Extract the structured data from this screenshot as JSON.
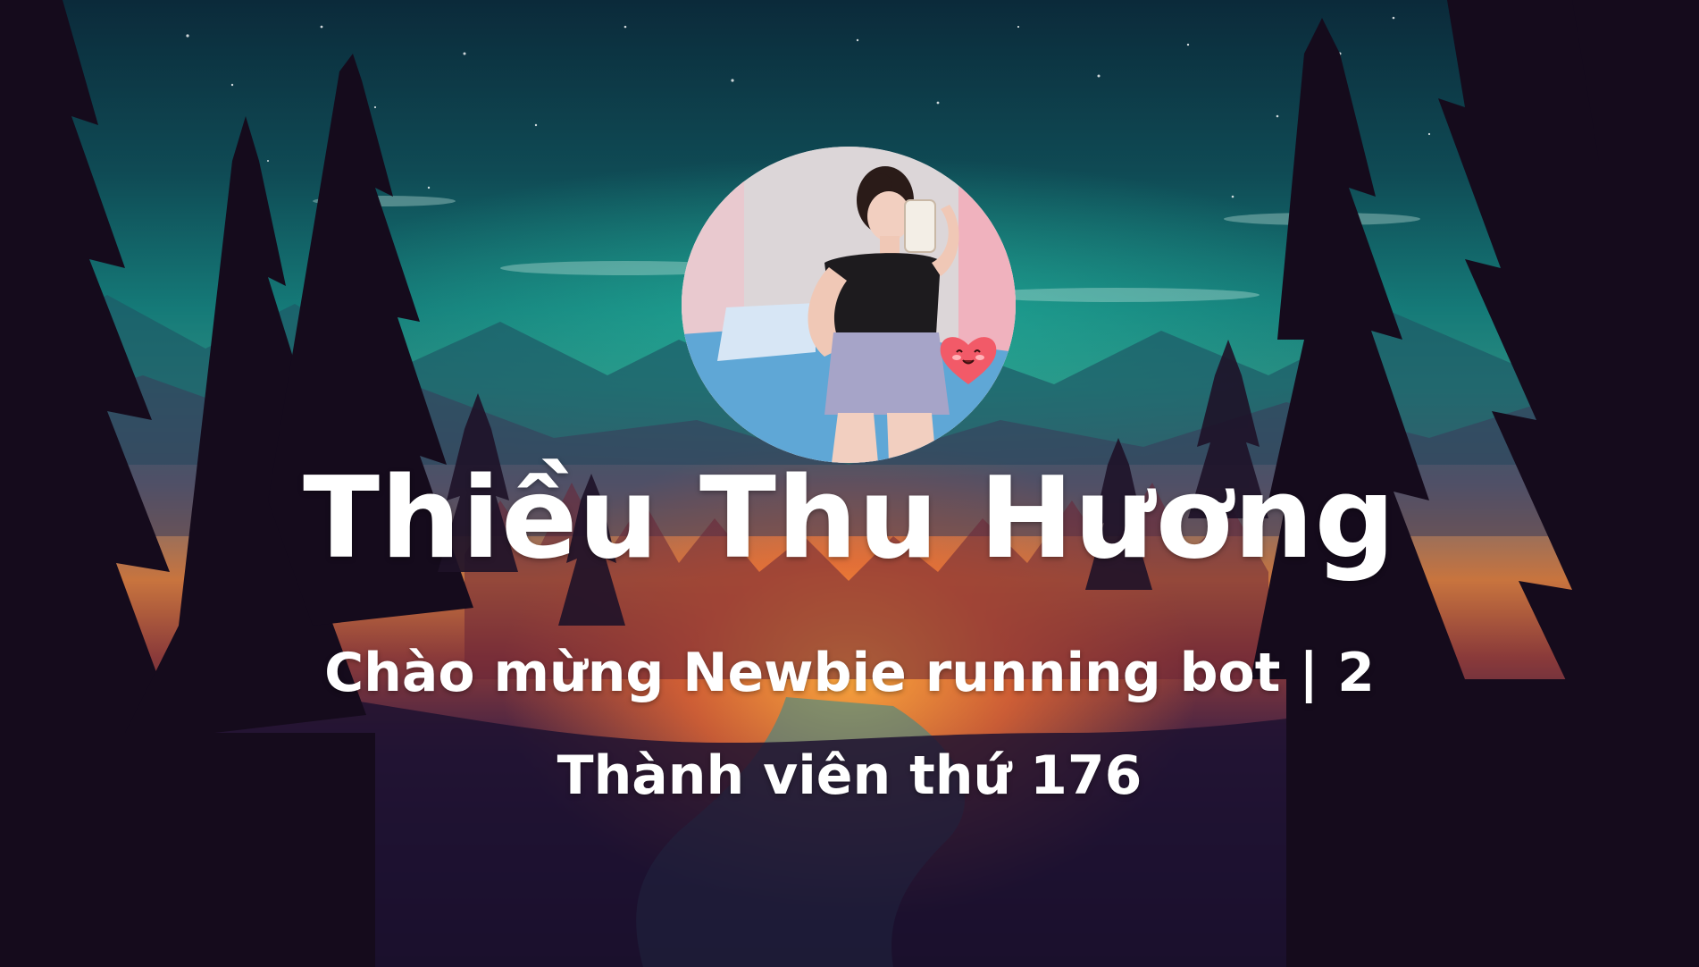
{
  "card": {
    "display_name": "Thiều Thu Hương",
    "welcome_text": "Chào mừng Newbie running bot | 2",
    "member_text": "Thành viên thứ  176"
  },
  "icons": {
    "avatar_sticker": "heart-face-icon"
  },
  "colors": {
    "text": "#ffffff",
    "sky_top": "#0b2a3a",
    "sky_teal": "#157a78",
    "sunset_orange": "#f0a040",
    "forest_dark": "#1a0f22"
  }
}
